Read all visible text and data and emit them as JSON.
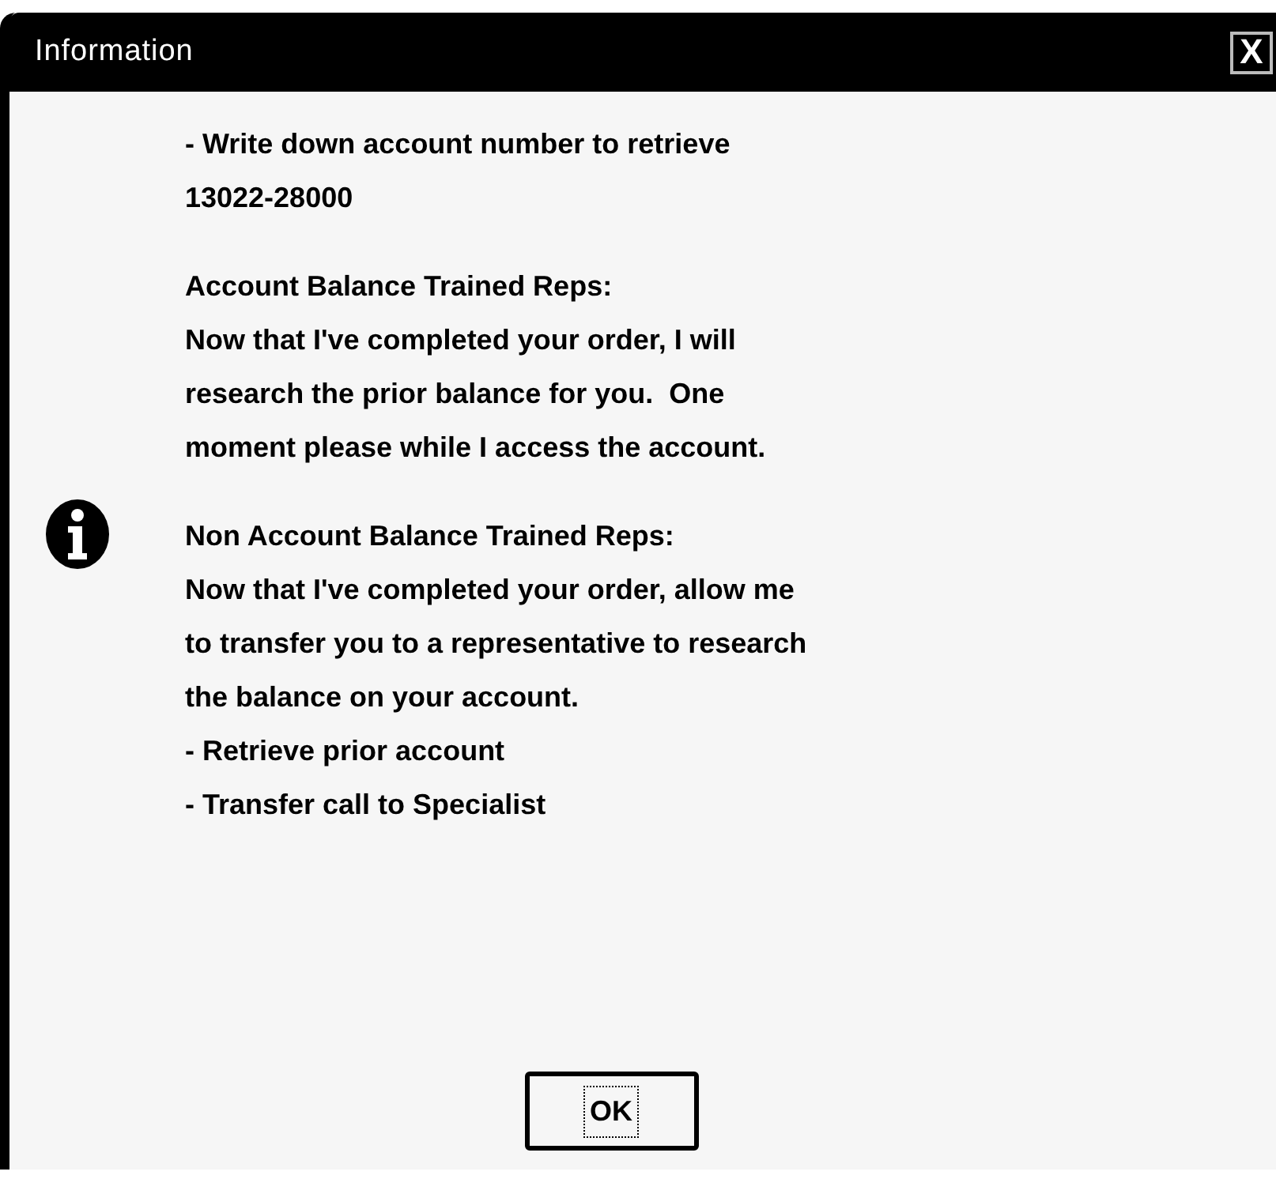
{
  "window": {
    "title": "Information",
    "close_label": "X"
  },
  "message": {
    "paragraphs": [
      {
        "lines": [
          "- Write down account number to retrieve",
          "13022-28000"
        ]
      },
      {
        "lines": [
          "Account Balance Trained Reps:",
          "Now that I've completed your order, I will",
          "research the prior balance for you.  One",
          "moment please while I access the account."
        ]
      },
      {
        "lines": [
          "Non Account Balance Trained Reps:",
          "Now that I've completed your order, allow me",
          "to transfer you to a representative to research",
          "the balance on your account.",
          "- Retrieve prior account",
          "- Transfer call to Specialist"
        ]
      }
    ]
  },
  "buttons": [
    {
      "label": "OK",
      "focused": true
    }
  ]
}
